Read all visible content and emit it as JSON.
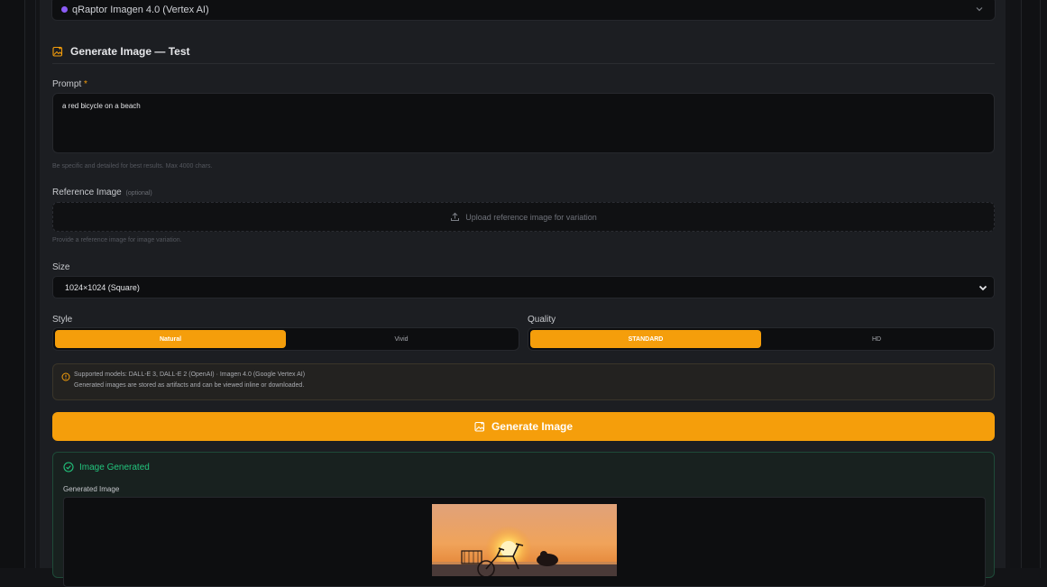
{
  "model": {
    "selected_label": "qRaptor Imagen 4.0 (Vertex AI)",
    "dot_color": "#8b5cf6"
  },
  "section": {
    "title": "Generate Image — Test",
    "icon": "image-sparkle-icon"
  },
  "prompt": {
    "label": "Prompt",
    "required_mark": "*",
    "value": "a red bicycle on a beach",
    "hint": "Be specific and detailed for best results. Max 4000 chars."
  },
  "reference": {
    "label": "Reference Image",
    "optional_tag": "(optional)",
    "upload_text": "Upload reference image for variation",
    "upload_icon": "upload-icon",
    "hint": "Provide a reference image for image variation."
  },
  "size": {
    "label": "Size",
    "selected": "1024×1024 (Square)"
  },
  "style": {
    "label": "Style",
    "options": [
      "Natural",
      "Vivid"
    ],
    "active": "Natural"
  },
  "quality": {
    "label": "Quality",
    "options": [
      "STANDARD",
      "HD"
    ],
    "active": "STANDARD"
  },
  "info": {
    "icon": "info-circle-icon",
    "line1": "Supported models: DALL-E 3, DALL-E 2 (OpenAI) · Imagen 4.0 (Google Vertex AI)",
    "line2": "Generated images are stored as artifacts and can be viewed inline or downloaded."
  },
  "generate_button": {
    "label": "Generate Image",
    "icon": "image-sparkle-icon"
  },
  "result": {
    "status": "Image Generated",
    "status_icon": "check-circle-icon",
    "sub_label": "Generated Image"
  },
  "colors": {
    "accent": "#f59e0b",
    "success": "#22c57d",
    "background": "#1c1e22"
  }
}
